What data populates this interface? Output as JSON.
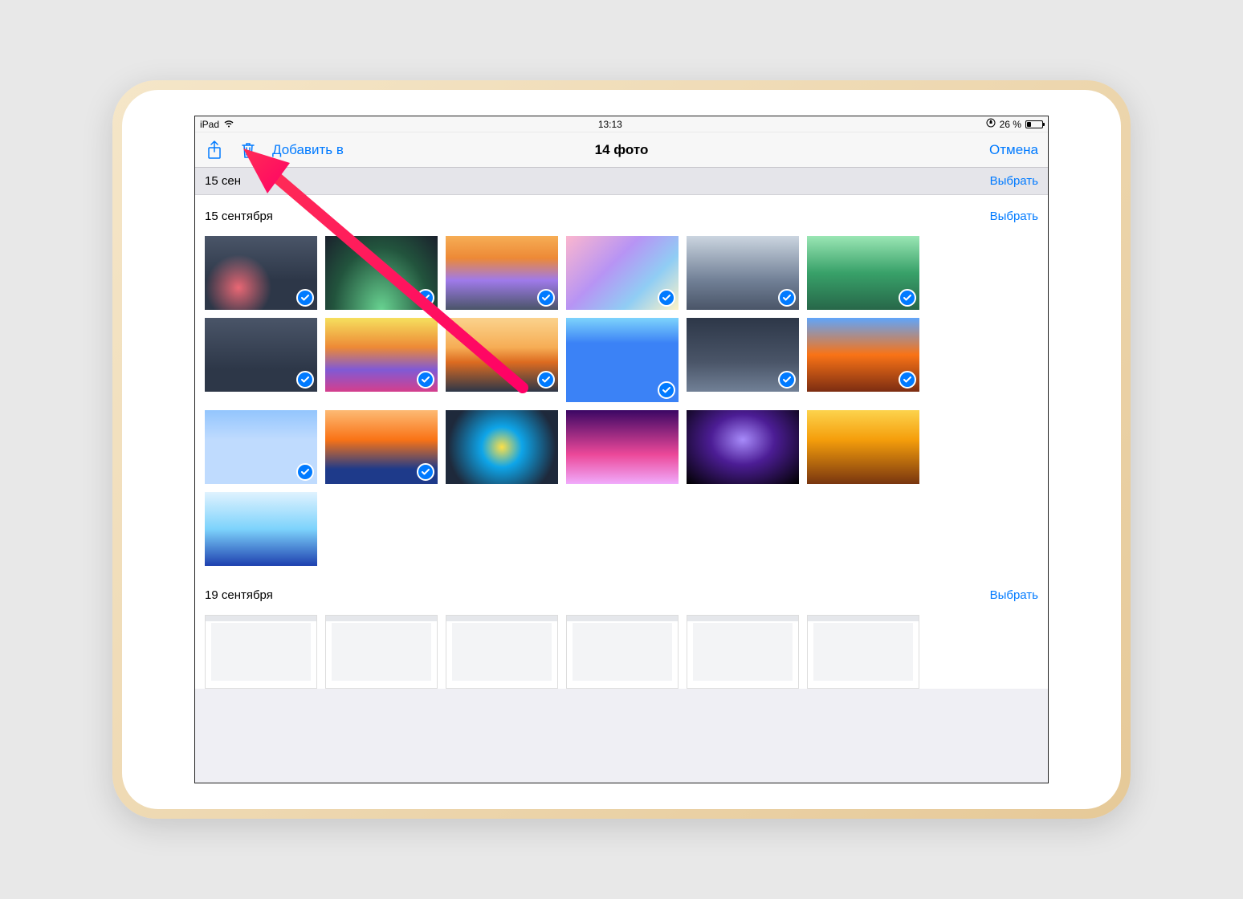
{
  "status": {
    "device": "iPad",
    "time": "13:13",
    "battery_pct": "26 %",
    "battery_fill_pct": 26
  },
  "nav": {
    "add_to": "Добавить в",
    "title": "14 фото",
    "cancel": "Отмена"
  },
  "sections": {
    "s0": {
      "date": "15 сен",
      "select": "Выбрать"
    },
    "s1": {
      "date": "15 сентября",
      "select": "Выбрать"
    },
    "s2": {
      "date": "19 сентября",
      "select": "Выбрать"
    }
  },
  "photos_s1": [
    {
      "selected": true,
      "cls": "g1"
    },
    {
      "selected": true,
      "cls": "g2"
    },
    {
      "selected": true,
      "cls": "g3"
    },
    {
      "selected": true,
      "cls": "g4"
    },
    {
      "selected": true,
      "cls": "g5"
    },
    {
      "selected": true,
      "cls": "g6"
    },
    {
      "selected": true,
      "cls": "g7"
    },
    {
      "selected": true,
      "cls": "g8"
    },
    {
      "selected": true,
      "cls": "g9"
    },
    {
      "selected": true,
      "cls": "g10",
      "tall": true
    },
    {
      "selected": true,
      "cls": "g11"
    },
    {
      "selected": true,
      "cls": "g12"
    },
    {
      "selected": true,
      "cls": "g13"
    },
    {
      "selected": true,
      "cls": "g14"
    },
    {
      "selected": false,
      "cls": "g15"
    },
    {
      "selected": false,
      "cls": "g16"
    },
    {
      "selected": false,
      "cls": "g17"
    },
    {
      "selected": false,
      "cls": "g18"
    },
    {
      "selected": false,
      "cls": "g19"
    }
  ],
  "photos_s2": [
    {
      "selected": false,
      "cls": "ss"
    },
    {
      "selected": false,
      "cls": "ss"
    },
    {
      "selected": false,
      "cls": "ss"
    },
    {
      "selected": false,
      "cls": "ss"
    },
    {
      "selected": false,
      "cls": "ss"
    },
    {
      "selected": false,
      "cls": "ss"
    }
  ]
}
